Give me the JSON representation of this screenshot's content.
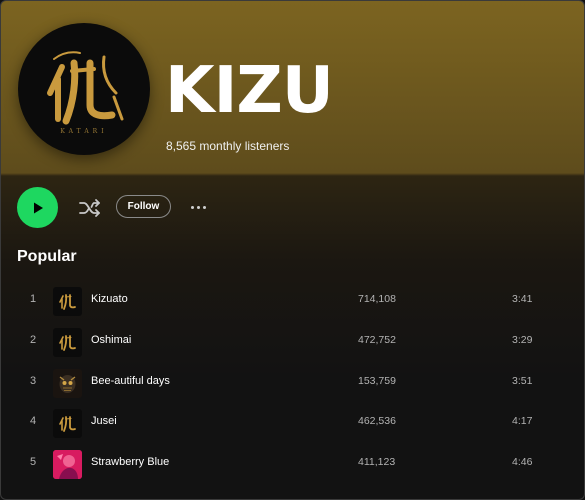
{
  "artist": {
    "name": "KIZU",
    "monthly_listeners": "8,565 monthly listeners",
    "avatar_text": "KATARI"
  },
  "actions": {
    "follow_label": "Follow"
  },
  "popular": {
    "title": "Popular",
    "tracks": [
      {
        "rank": "1",
        "title": "Kizuato",
        "plays": "714,108",
        "duration": "3:41",
        "cover": "kanji-logo"
      },
      {
        "rank": "2",
        "title": "Oshimai",
        "plays": "472,752",
        "duration": "3:29",
        "cover": "kanji-logo"
      },
      {
        "rank": "3",
        "title": "Bee-autiful days",
        "plays": "153,759",
        "duration": "3:51",
        "cover": "bee-mask-art"
      },
      {
        "rank": "4",
        "title": "Jusei",
        "plays": "462,536",
        "duration": "4:17",
        "cover": "kanji-logo"
      },
      {
        "rank": "5",
        "title": "Strawberry Blue",
        "plays": "411,123",
        "duration": "4:46",
        "cover": "pink-portrait-art"
      }
    ]
  },
  "colors": {
    "accent_green": "#1ed760",
    "header_gold": "#7c6420",
    "background": "#121212",
    "logo_gold": "#c99a3e"
  }
}
